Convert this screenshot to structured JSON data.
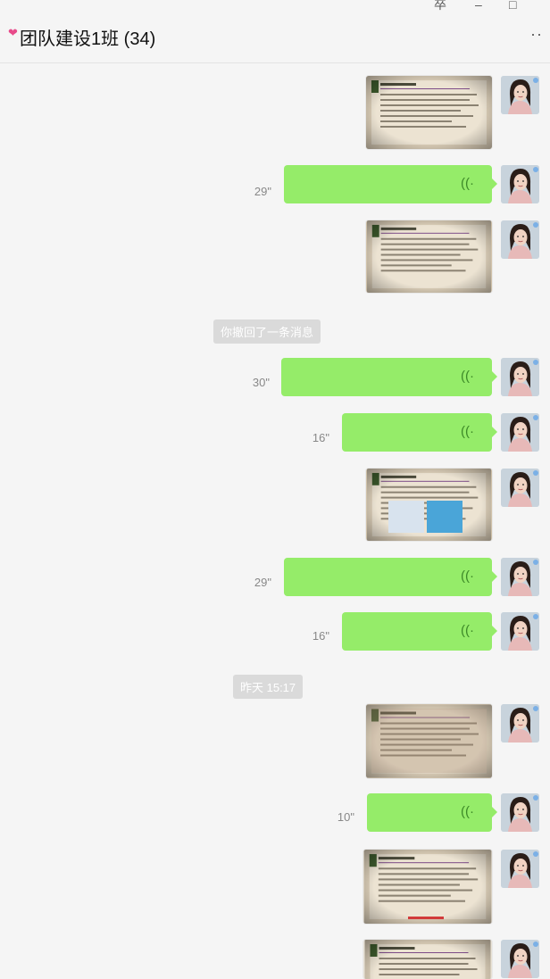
{
  "window": {
    "pin_glyph": "卒",
    "min_glyph": "–",
    "max_glyph": "□"
  },
  "header": {
    "title": "团队建设1班 (34)",
    "more_label": "··"
  },
  "messages": {
    "voice_1": {
      "duration": "29\""
    },
    "voice_2": {
      "duration": "30\""
    },
    "voice_3": {
      "duration": "16\""
    },
    "voice_4": {
      "duration": "29\""
    },
    "voice_5": {
      "duration": "16\""
    },
    "voice_6": {
      "duration": "10\""
    },
    "recall_notice": "你撤回了一条消息",
    "timestamp": "昨天 15:17"
  },
  "icons": {
    "voice_wave": "((·"
  },
  "colors": {
    "bubble": "#95ec69",
    "background": "#f5f5f5"
  }
}
